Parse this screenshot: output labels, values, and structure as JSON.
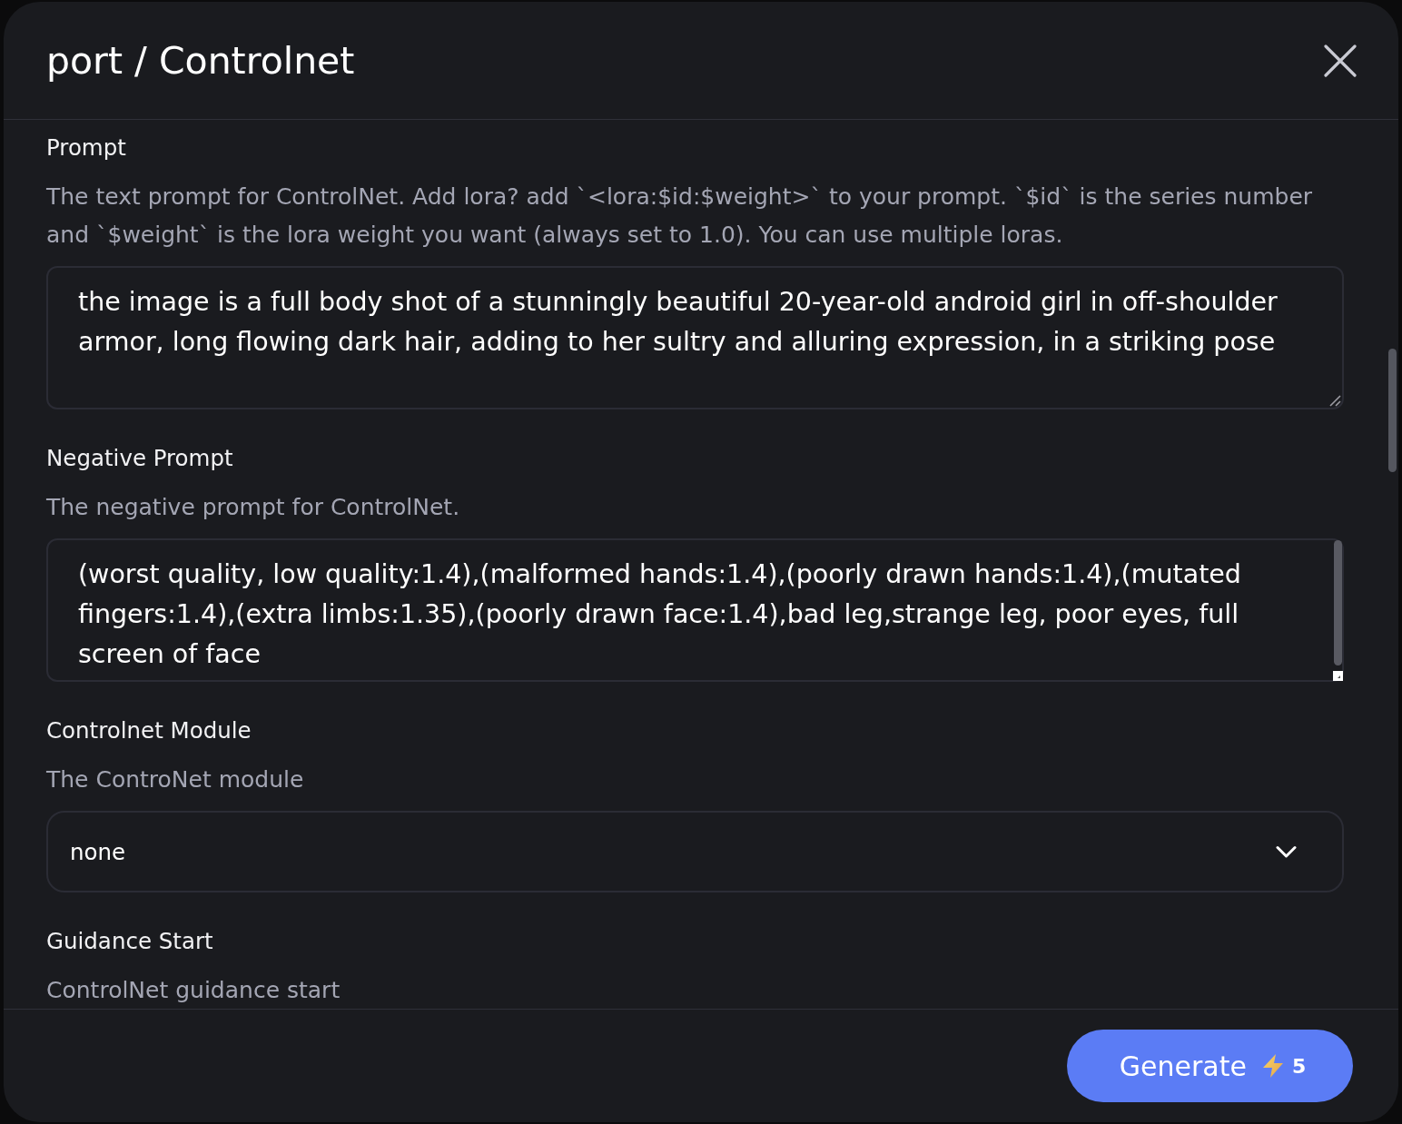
{
  "dialog": {
    "title": "port / Controlnet"
  },
  "fields": [
    {
      "kind": "textarea",
      "label": "Prompt",
      "description": "The text prompt for ControlNet. Add lora? add `<lora:$id:$weight>` to your prompt. `$id` is the series number and `$weight` is the lora weight you want (always set to 1.0). You can use multiple loras.",
      "value": "the image is a full body shot of a stunningly beautiful 20-year-old android girl in off-shoulder armor, long flowing dark hair, adding to her sultry and alluring expression, in a striking pose",
      "scrollbar": false
    },
    {
      "kind": "textarea",
      "label": "Negative Prompt",
      "description": "The negative prompt for ControlNet.",
      "value": "(worst quality, low quality:1.4),(malformed hands:1.4),(poorly drawn hands:1.4),(mutated fingers:1.4),(extra limbs:1.35),(poorly drawn face:1.4),bad leg,strange leg, poor eyes, full screen of face",
      "scrollbar": true
    },
    {
      "kind": "select",
      "label": "Controlnet Module",
      "description": "The ControNet module",
      "value": "none"
    },
    {
      "kind": "note",
      "label": "Guidance Start",
      "description": "ControlNet guidance start"
    }
  ],
  "footer": {
    "generate_button": {
      "label": "Generate",
      "cost": "5"
    }
  }
}
